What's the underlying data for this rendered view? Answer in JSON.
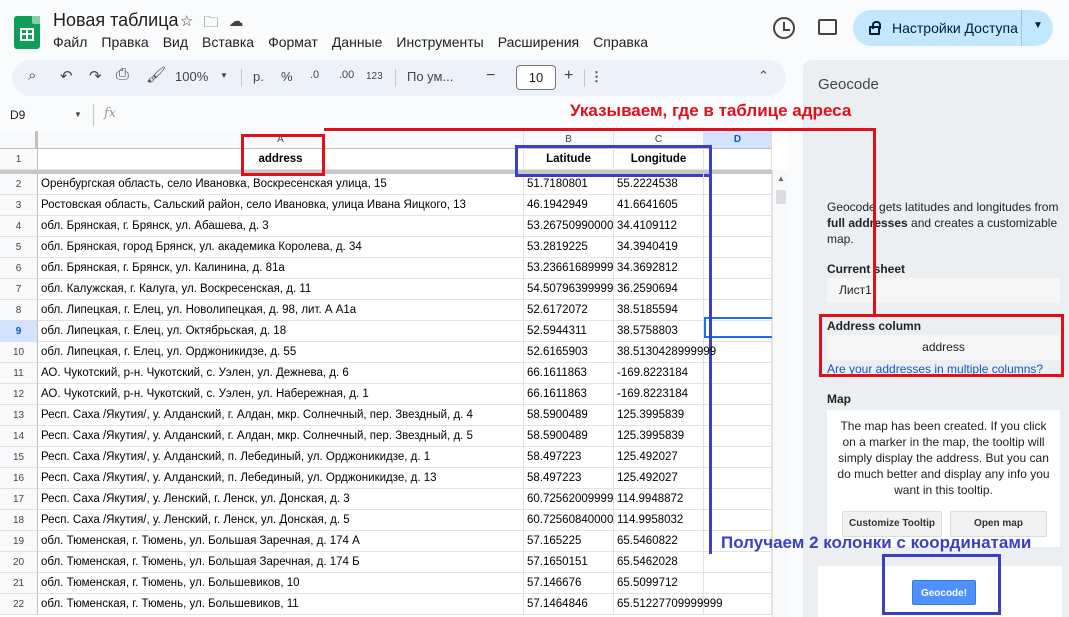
{
  "app": {
    "doc_title": "Новая таблица",
    "menu": [
      "Файл",
      "Правка",
      "Вид",
      "Вставка",
      "Формат",
      "Данные",
      "Инструменты",
      "Расширения",
      "Справка"
    ],
    "share_label": "Настройки Доступа"
  },
  "toolbar": {
    "zoom": "100%",
    "currency": "р.",
    "percent": "%",
    "dec_decrease": ".0",
    "dec_increase": ".00",
    "number_format": "123",
    "font": "По ум...",
    "minus": "−",
    "font_size": "10",
    "plus": "+"
  },
  "formula_bar": {
    "cell_ref": "D9",
    "fx": "fx"
  },
  "sheet": {
    "columns": [
      "A",
      "B",
      "C",
      "D"
    ],
    "selected_column": "D",
    "selected_row": "9",
    "header_row": {
      "num": "1",
      "a": "address",
      "b": "Latitude",
      "c": "Longitude"
    },
    "rows": [
      {
        "num": "2",
        "a": "Оренбургская область, село Ивановка, Воскресенская улица, 15",
        "b": "51.7180801",
        "c": "55.2224538"
      },
      {
        "num": "3",
        "a": "Ростовская область, Сальский район, село Ивановка, улица Ивана Яицкого, 13",
        "b": "46.1942949",
        "c": "41.6641605"
      },
      {
        "num": "4",
        "a": "обл. Брянская, г. Брянск, ул. Абашева, д. 3",
        "b": "53.26750990000",
        "c": "34.4109112"
      },
      {
        "num": "5",
        "a": "обл. Брянская, город Брянск, ул. академика Королева, д. 34",
        "b": "53.2819225",
        "c": "34.3940419"
      },
      {
        "num": "6",
        "a": "обл. Брянская, г. Брянск, ул. Калинина, д. 81а",
        "b": "53.23661689999",
        "c": "34.3692812"
      },
      {
        "num": "7",
        "a": "обл. Калужская, г. Калуга, ул. Воскресенская, д. 11",
        "b": "54.50796399999",
        "c": "36.2590694"
      },
      {
        "num": "8",
        "a": "обл. Липецкая, г. Елец, ул. Новолипецкая, д. 98, лит. А А1а",
        "b": "52.6172072",
        "c": "38.5185594"
      },
      {
        "num": "9",
        "a": "обл. Липецкая, г. Елец, ул. Октябрьская, д. 18",
        "b": "52.5944311",
        "c": "38.5758803"
      },
      {
        "num": "10",
        "a": "обл. Липецкая, г. Елец, ул. Орджоникидзе, д. 55",
        "b": "52.6165903",
        "c": "38.5130428999999"
      },
      {
        "num": "11",
        "a": "АО. Чукотский, р-н. Чукотский, с. Уэлен, ул. Дежнева, д. 6",
        "b": "66.1611863",
        "c": "-169.8223184"
      },
      {
        "num": "12",
        "a": "АО. Чукотский, р-н. Чукотский, с. Уэлен, ул. Набережная, д. 1",
        "b": "66.1611863",
        "c": "-169.8223184"
      },
      {
        "num": "13",
        "a": "Респ. Саха /Якутия/, у. Алданский, г. Алдан, мкр. Солнечный, пер. Звездный, д. 4",
        "b": "58.5900489",
        "c": "125.3995839"
      },
      {
        "num": "14",
        "a": "Респ. Саха /Якутия/, у. Алданский, г. Алдан, мкр. Солнечный, пер. Звездный, д. 5",
        "b": "58.5900489",
        "c": "125.3995839"
      },
      {
        "num": "15",
        "a": "Респ. Саха /Якутия/, у. Алданский, п. Лебединый, ул. Орджоникидзе, д. 1",
        "b": "58.497223",
        "c": "125.492027"
      },
      {
        "num": "16",
        "a": "Респ. Саха /Якутия/, у. Алданский, п. Лебединый, ул. Орджоникидзе, д. 13",
        "b": "58.497223",
        "c": "125.492027"
      },
      {
        "num": "17",
        "a": "Респ. Саха /Якутия/, у. Ленский, г. Ленск, ул. Донская, д. 3",
        "b": "60.72562009999",
        "c": "114.9948872"
      },
      {
        "num": "18",
        "a": "Респ. Саха /Якутия/, у. Ленский, г. Ленск, ул. Донская, д. 5",
        "b": "60.72560840000",
        "c": "114.9958032"
      },
      {
        "num": "19",
        "a": "обл. Тюменская, г. Тюмень, ул. Большая Заречная, д. 174 А",
        "b": "57.165225",
        "c": "65.5460822"
      },
      {
        "num": "20",
        "a": "обл. Тюменская, г. Тюмень, ул. Большая Заречная, д. 174 Б",
        "b": "57.1650151",
        "c": "65.5462028"
      },
      {
        "num": "21",
        "a": "обл. Тюменская, г. Тюмень, ул. Большевиков, 10",
        "b": "57.146676",
        "c": "65.5099712"
      },
      {
        "num": "22",
        "a": "обл. Тюменская, г. Тюмень, ул. Большевиков,  11",
        "b": "57.1464846",
        "c": "65.51227709999999"
      }
    ]
  },
  "panel": {
    "title": "Geocode",
    "intro_1": "Geocode gets latitudes and longitudes from",
    "intro_bold": "full addresses",
    "intro_2": " and creates a customizable",
    "intro_3": "map.",
    "current_sheet_label": "Current sheet",
    "current_sheet_value": "Лист1",
    "address_column_label": "Address column",
    "address_column_value": "address",
    "multi_columns_link": "Are your addresses in multiple columns?",
    "map_label": "Map",
    "map_text": [
      "The map has been created. If you click",
      "on a marker in the map, the tooltip will",
      "simply display the address. But you can",
      "do much better and display any info you",
      "want in this tooltip."
    ],
    "customize_btn": "Customize Tooltip",
    "open_map_btn": "Open map",
    "geocode_btn": "Geocode!"
  },
  "annotations": {
    "red_text": "Указываем, где в таблице адреса",
    "blue_text": "Получаем 2 колонки с координатами"
  },
  "colors": {
    "annotation_red": "#e0101a",
    "annotation_blue": "#3a3fc4",
    "sheets_green": "#0f9d58",
    "share_button_bg": "#c2e7ff",
    "geocode_button": "#4d90fe"
  },
  "icons": [
    "sheets-logo-icon",
    "star-icon",
    "folder-move-icon",
    "cloud-status-icon",
    "history-icon",
    "comment-icon",
    "lock-icon",
    "search-icon",
    "undo-icon",
    "redo-icon",
    "print-icon",
    "paint-format-icon",
    "more-vert-icon",
    "chevron-up-icon"
  ]
}
